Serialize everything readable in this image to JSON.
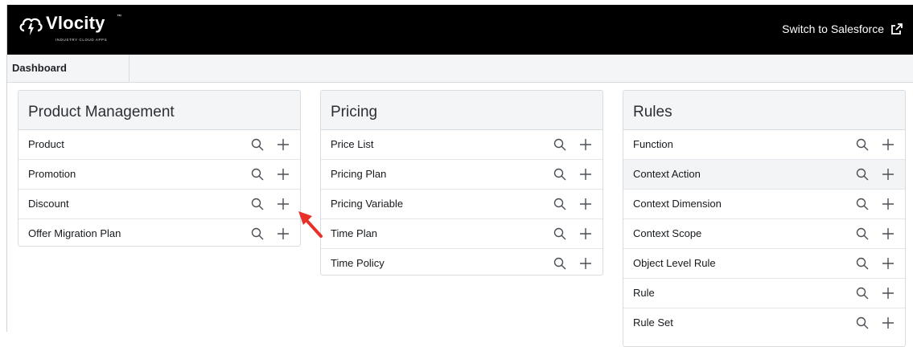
{
  "brand": {
    "name": "Vlocity",
    "tagline": "INDUSTRY CLOUD APPS",
    "trademark": "™"
  },
  "header": {
    "switch_label": "Switch to Salesforce"
  },
  "tabs": [
    {
      "label": "Dashboard"
    }
  ],
  "cards": [
    {
      "title": "Product Management",
      "items": [
        {
          "label": "Product"
        },
        {
          "label": "Promotion"
        },
        {
          "label": "Discount"
        },
        {
          "label": "Offer Migration Plan"
        }
      ]
    },
    {
      "title": "Pricing",
      "items": [
        {
          "label": "Price List"
        },
        {
          "label": "Pricing Plan"
        },
        {
          "label": "Pricing Variable"
        },
        {
          "label": "Time Plan"
        },
        {
          "label": "Time Policy"
        }
      ]
    },
    {
      "title": "Rules",
      "items": [
        {
          "label": "Function"
        },
        {
          "label": "Context Action"
        },
        {
          "label": "Context Dimension"
        },
        {
          "label": "Context Scope"
        },
        {
          "label": "Object Level Rule"
        },
        {
          "label": "Rule"
        },
        {
          "label": "Rule Set"
        }
      ]
    }
  ],
  "icons": {
    "search": "search-icon",
    "add": "plus-icon",
    "external": "external-link-icon",
    "annotation": "red-arrow-icon"
  },
  "colors": {
    "topbar": "#000000",
    "annotation_arrow": "#e8302a",
    "icon": "#4a4f55"
  }
}
